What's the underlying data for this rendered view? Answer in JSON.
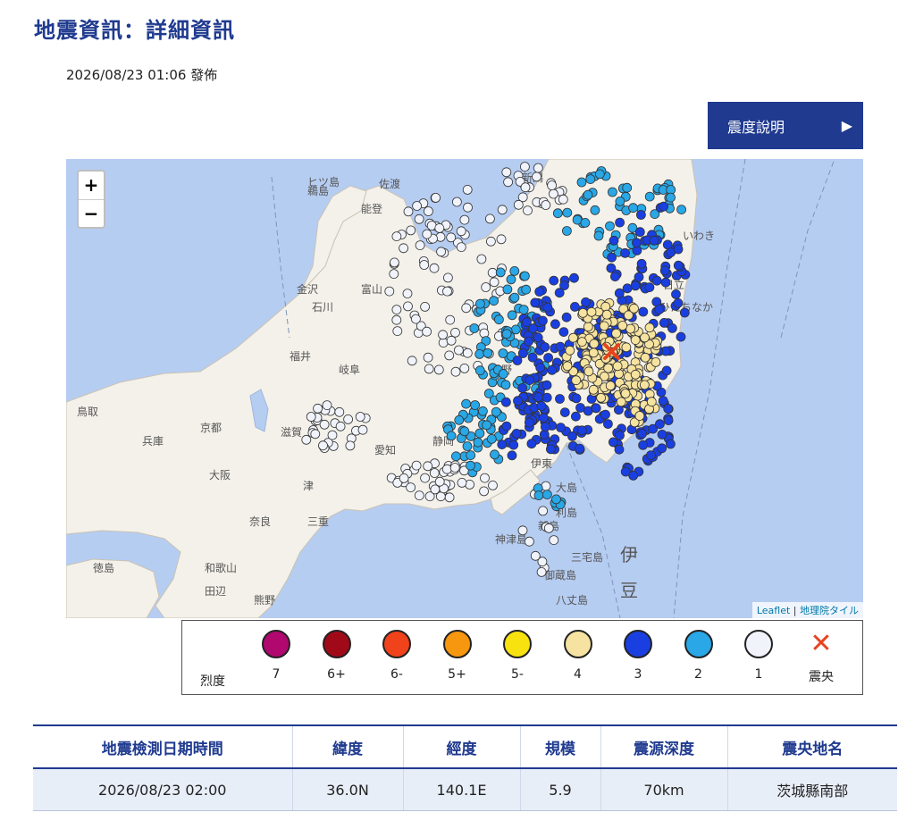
{
  "page": {
    "title": "地震資訊：詳細資訊",
    "published": "2026/08/23 01:06 發佈",
    "intensity_button": "震度說明",
    "intensity_button_icon": "play-icon"
  },
  "map": {
    "zoom_in": "+",
    "zoom_out": "−",
    "attribution_leaflet": "Leaflet",
    "attribution_separator": "|",
    "attribution_tiles": "地理院タイル",
    "labels": [
      "ヒツ島",
      "新潟",
      "鵜島",
      "佐渡",
      "能登",
      "富山",
      "石川",
      "福井",
      "金沢",
      "岐阜",
      "鳥取",
      "兵庫",
      "京都",
      "大阪",
      "奈良",
      "三重",
      "和歌山",
      "徳島",
      "愛知",
      "静岡",
      "伊東",
      "大島",
      "利島",
      "新島",
      "神津島",
      "三宅島",
      "御蔵島",
      "八丈島",
      "伊",
      "豆",
      "いわき",
      "日立",
      "ひたちなか",
      "長野",
      "滋賀",
      "津",
      "田辺",
      "熊野"
    ],
    "epicenter": {
      "lat": 36.0,
      "lon": 140.1
    },
    "colors": {
      "sea": "#b6cdf2",
      "land": "#f3f1ea",
      "i4": "#f6e3a0",
      "i3": "#1a3fe0",
      "i2": "#29a7e6",
      "i1": "#f1f3fb",
      "epicenter": "#e8431e"
    }
  },
  "legend": {
    "label": "烈度",
    "items": [
      {
        "text": "7",
        "color": "#b0086f"
      },
      {
        "text": "6+",
        "color": "#a00a18"
      },
      {
        "text": "6-",
        "color": "#f0421b"
      },
      {
        "text": "5+",
        "color": "#f6970f"
      },
      {
        "text": "5-",
        "color": "#f7e210"
      },
      {
        "text": "4",
        "color": "#f7e3a1"
      },
      {
        "text": "3",
        "color": "#1a3fe0"
      },
      {
        "text": "2",
        "color": "#29a7e6"
      },
      {
        "text": "1",
        "color": "#f1f3fb"
      }
    ],
    "epicenter_label": "震央"
  },
  "table": {
    "headers": [
      "地震檢測日期時間",
      "緯度",
      "經度",
      "規模",
      "震源深度",
      "震央地名"
    ],
    "row": [
      "2026/08/23 02:00",
      "36.0N",
      "140.1E",
      "5.9",
      "70km",
      "茨城縣南部"
    ]
  }
}
